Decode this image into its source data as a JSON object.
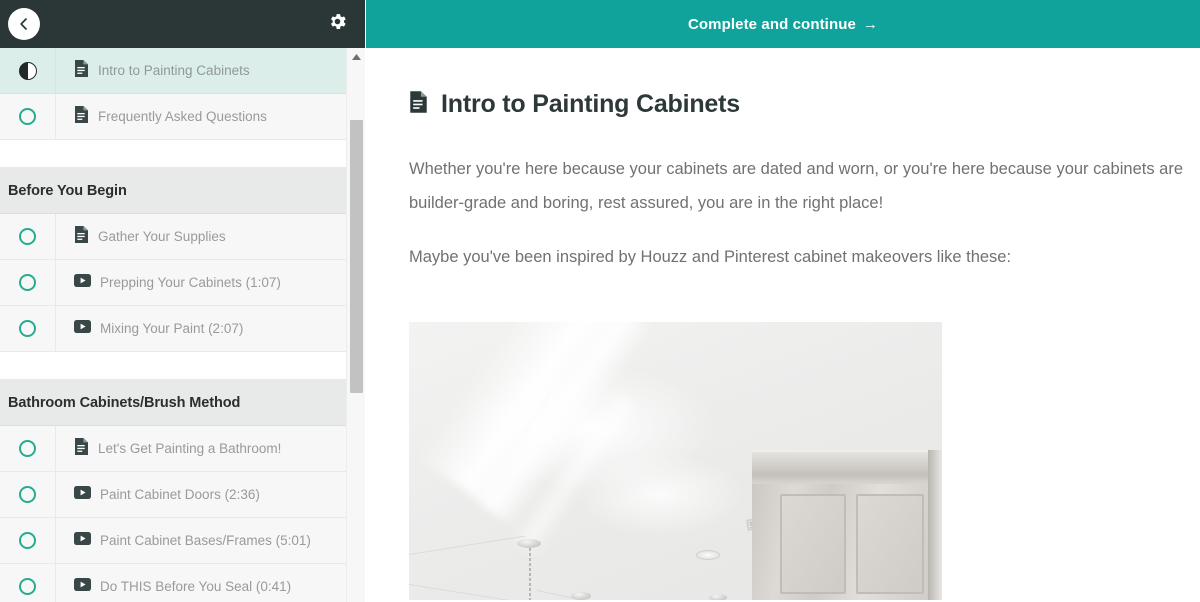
{
  "sidebar": {
    "back_icon": "chevron-left-icon",
    "settings_icon": "gear-icon",
    "scroll_up_icon": "scroll-up-arrow-icon",
    "groups": [
      {
        "type": "lectures",
        "items": [
          {
            "label": "Intro to Painting Cabinets",
            "icon": "document-icon",
            "status": "in-progress",
            "active": true
          },
          {
            "label": "Frequently Asked Questions",
            "icon": "document-icon",
            "status": "incomplete",
            "active": false
          }
        ]
      },
      {
        "type": "section",
        "title": "Before You Begin",
        "items": [
          {
            "label": "Gather Your Supplies",
            "icon": "document-icon",
            "status": "incomplete",
            "active": false
          },
          {
            "label": "Prepping Your Cabinets (1:07)",
            "icon": "video-icon",
            "status": "incomplete",
            "active": false
          },
          {
            "label": "Mixing Your Paint (2:07)",
            "icon": "video-icon",
            "status": "incomplete",
            "active": false
          }
        ]
      },
      {
        "type": "section",
        "title": "Bathroom Cabinets/Brush Method",
        "items": [
          {
            "label": "Let's Get Painting a Bathroom!",
            "icon": "document-icon",
            "status": "incomplete",
            "active": false
          },
          {
            "label": "Paint Cabinet Doors (2:36)",
            "icon": "video-icon",
            "status": "incomplete",
            "active": false
          },
          {
            "label": "Paint Cabinet Bases/Frames (5:01)",
            "icon": "video-icon",
            "status": "incomplete",
            "active": false
          },
          {
            "label": "Do THIS Before You Seal (0:41)",
            "icon": "video-icon",
            "status": "incomplete",
            "active": false
          }
        ]
      }
    ]
  },
  "topbar": {
    "complete_label": "Complete and continue",
    "arrow_glyph": "→"
  },
  "main": {
    "title": "Intro to Painting Cabinets",
    "title_icon": "document-icon",
    "paragraphs": [
      "Whether you're here because your cabinets are dated and worn, or you're here because your cabinets are builder-grade and boring, rest assured, you are in the right place!",
      "Maybe you've been inspired by Houzz and Pinterest cabinet makeovers like these:"
    ],
    "image_alt": "white-kitchen-ceiling-photo"
  },
  "colors": {
    "teal": "#0fa39c",
    "header_dark": "#2b3736",
    "ring_teal": "#2aab91",
    "active_row": "#dceeea",
    "section_bg": "#e8e9e9"
  }
}
